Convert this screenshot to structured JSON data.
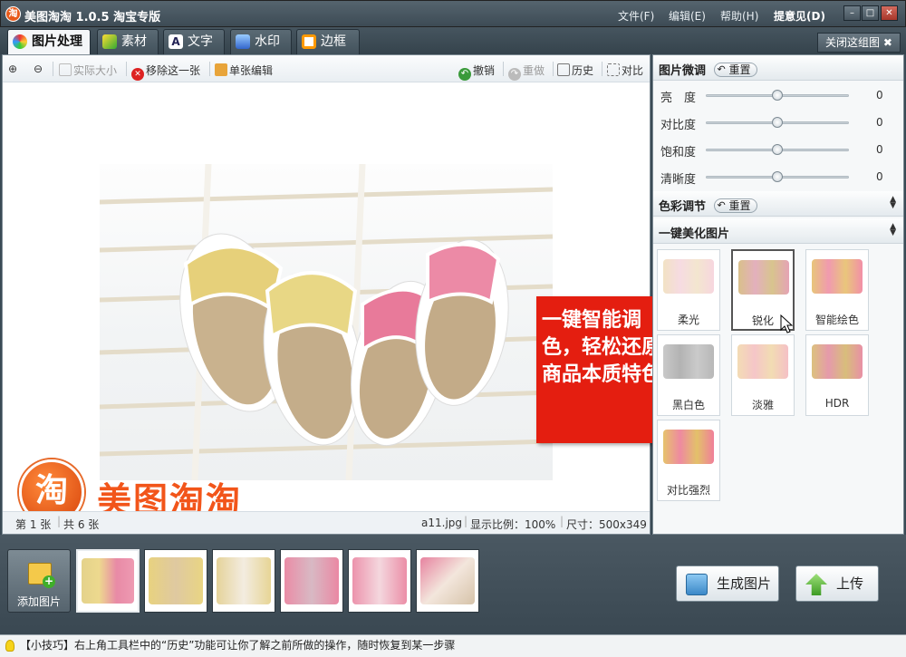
{
  "title": {
    "app": "美图淘淘 1.0.5 淘宝专版",
    "logo_char": "淘"
  },
  "menu": [
    "文件(F)",
    "编辑(E)",
    "帮助(H)",
    "提意见(D)"
  ],
  "window_buttons": [
    "▭",
    "–",
    "□",
    "✕"
  ],
  "tabs": [
    "图片处理",
    "素材",
    "文字",
    "水印",
    "边框"
  ],
  "close_group": "关闭这组图",
  "toolbar": {
    "actual_size": "实际大小",
    "remove": "移除这一张",
    "single_edit": "单张编辑",
    "undo": "撤销",
    "redo": "重做",
    "history": "历史",
    "compare": "对比"
  },
  "status": {
    "index": "第 1 张",
    "total": "共 6 张",
    "filename": "a11.jpg",
    "zoom": "显示比例：100%",
    "size": "尺寸：500x349"
  },
  "watermark": {
    "logo_char": "淘",
    "text": "美图淘淘"
  },
  "callout": "一键智能调色，轻松还原商品本质特色",
  "panel": {
    "fine_tune_title": "图片微调",
    "reset": "重置",
    "sliders": [
      {
        "label": "亮　度",
        "value": "0",
        "level": 0.5
      },
      {
        "label": "对比度",
        "value": "0",
        "level": 0.5
      },
      {
        "label": "饱和度",
        "value": "0",
        "level": 0.5
      },
      {
        "label": "清晰度",
        "value": "0",
        "level": 0.5
      }
    ],
    "color_title": "色彩调节",
    "beautify_title": "一键美化图片",
    "effects": [
      "柔光",
      "锐化",
      "智能绘色",
      "黑白色",
      "淡雅",
      "HDR",
      "对比强烈"
    ],
    "selected_effect": "锐化"
  },
  "add_image": "添加图片",
  "generate": "生成图片",
  "upload": "上传",
  "tip": "【小技巧】右上角工具栏中的“历史”功能可让你了解之前所做的操作，随时恢复到某一步骤",
  "colors": {
    "accent_red": "#e41e10",
    "brand_orange": "#e85a1a",
    "chrome_dark": "#3a4a55"
  }
}
